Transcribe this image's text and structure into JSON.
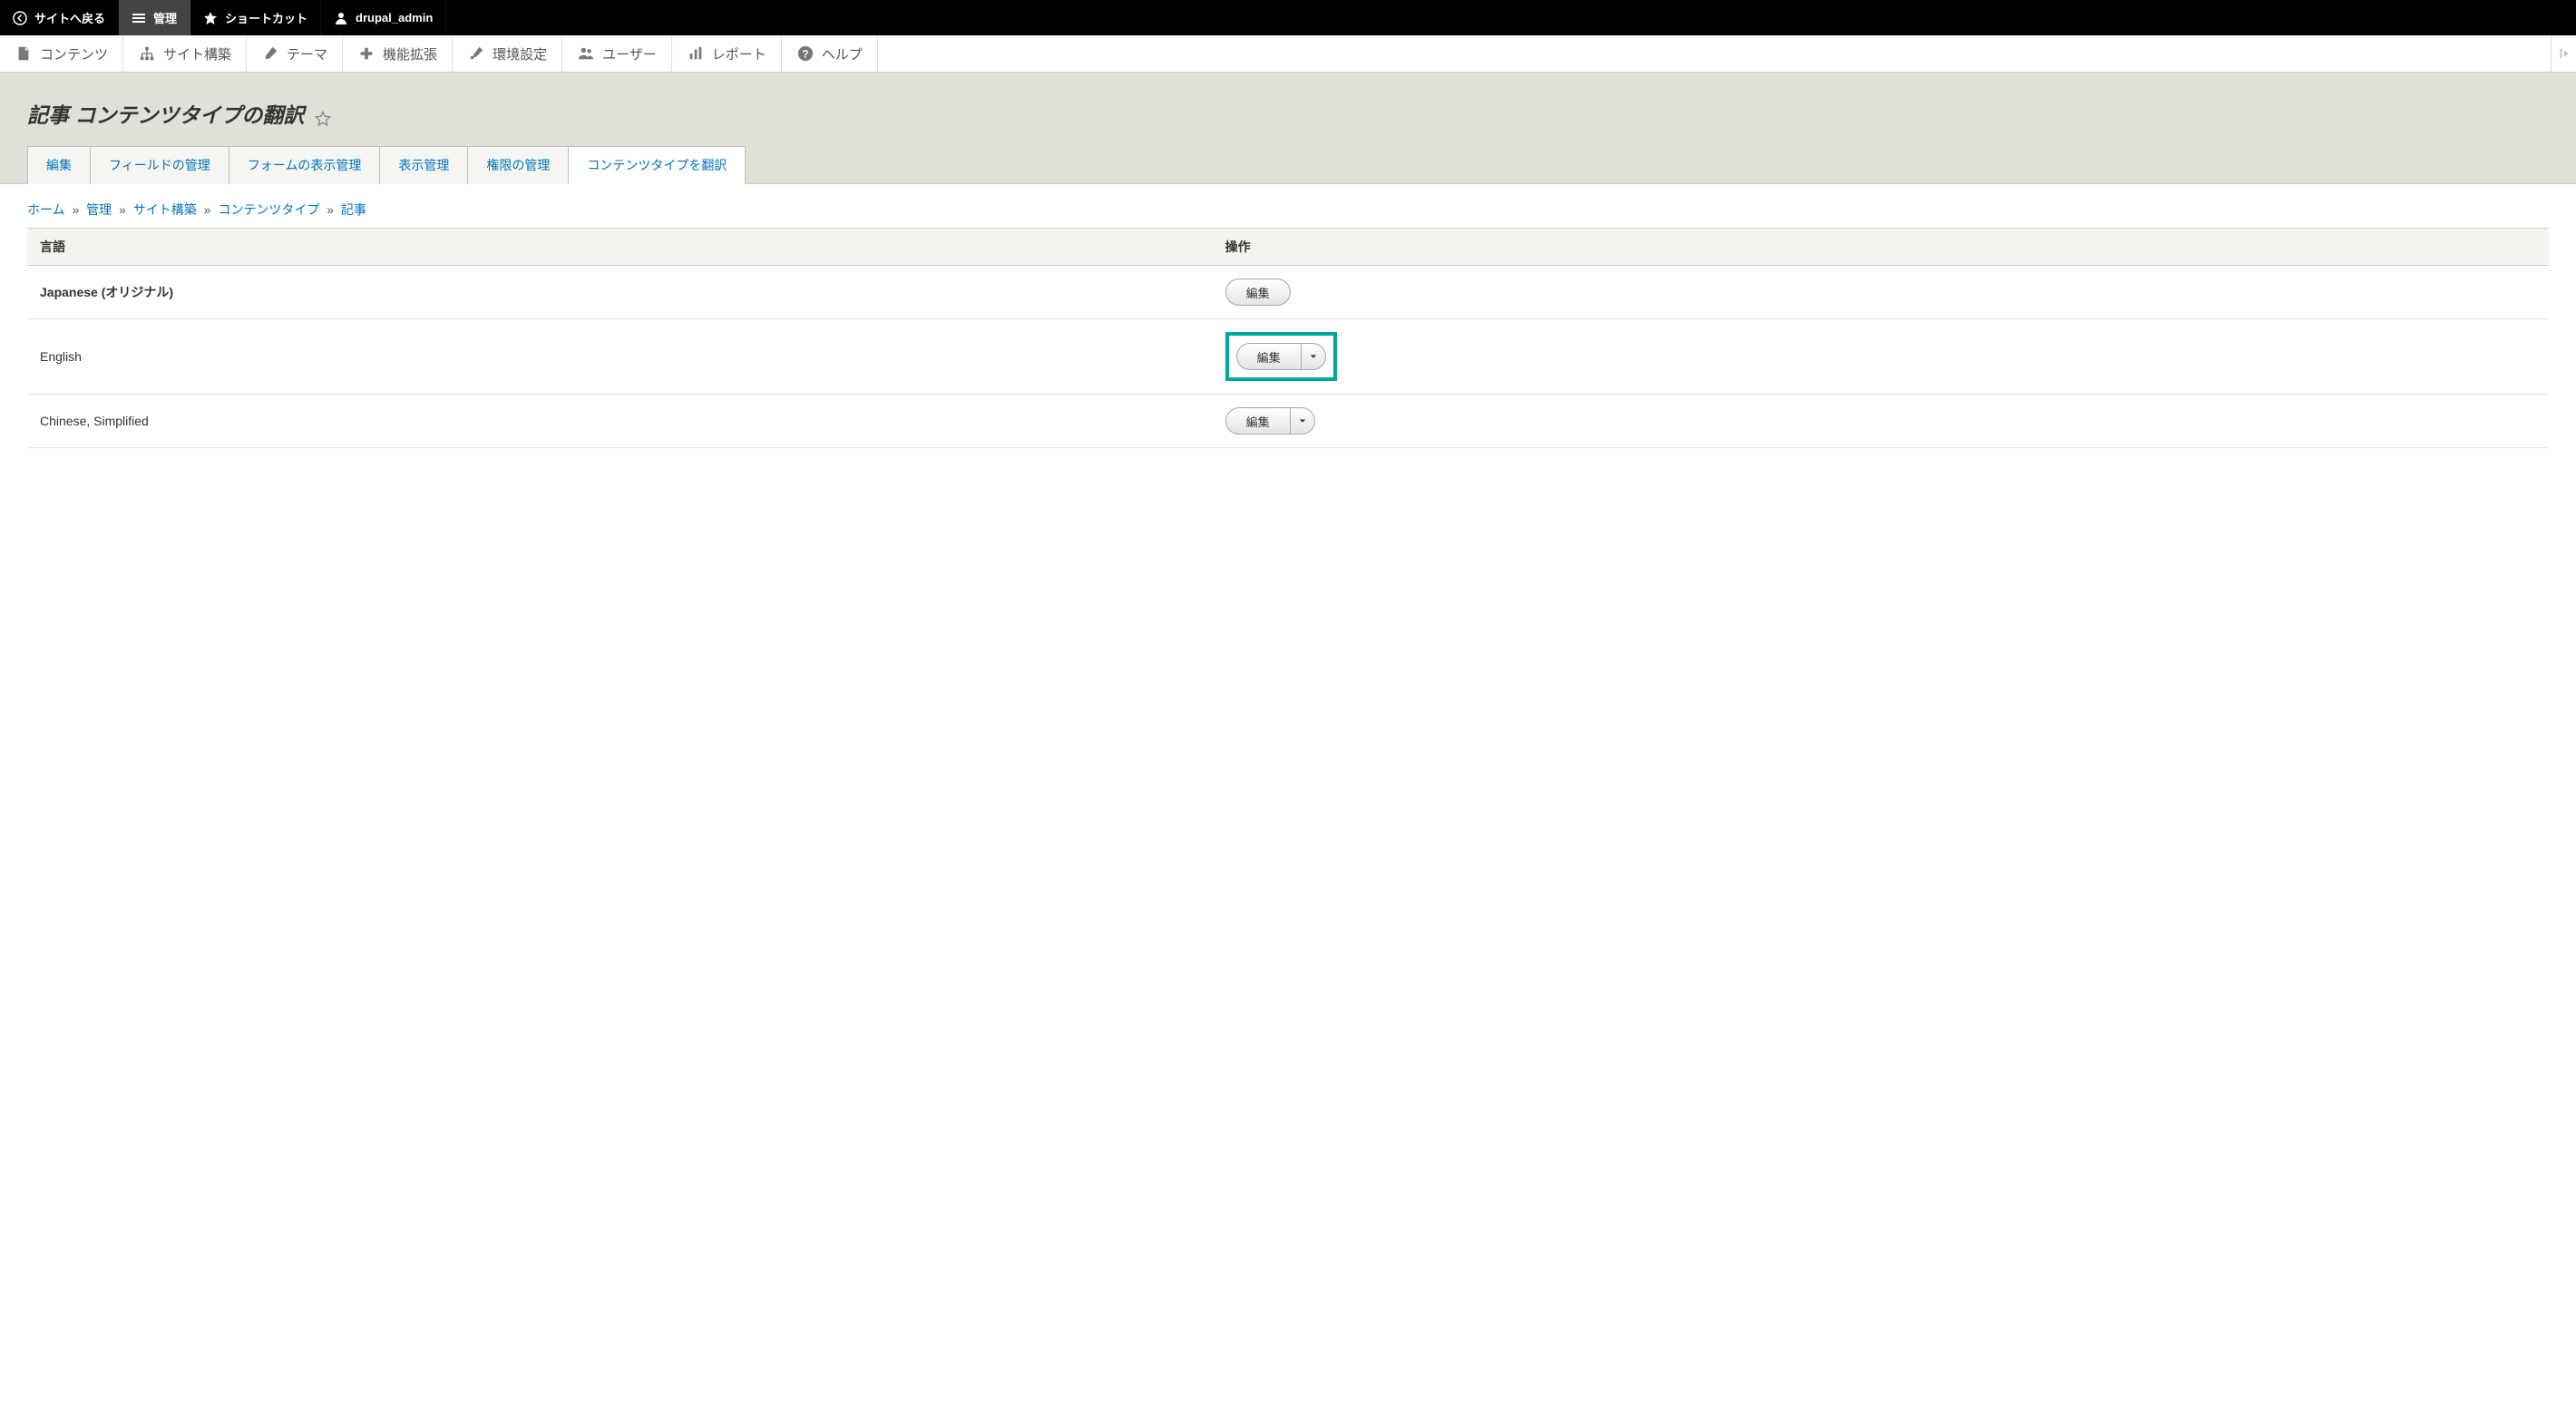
{
  "toolbar": {
    "back_to_site": "サイトへ戻る",
    "manage": "管理",
    "shortcuts": "ショートカット",
    "user": "drupal_admin"
  },
  "admin_menu": {
    "content": "コンテンツ",
    "structure": "サイト構築",
    "appearance": "テーマ",
    "extend": "機能拡張",
    "config": "環境設定",
    "people": "ユーザー",
    "reports": "レポート",
    "help": "ヘルプ"
  },
  "page_title": "記事 コンテンツタイプの翻訳",
  "tabs": {
    "edit": "編集",
    "manage_fields": "フィールドの管理",
    "manage_form_display": "フォームの表示管理",
    "manage_display": "表示管理",
    "manage_permissions": "権限の管理",
    "translate": "コンテンツタイプを翻訳"
  },
  "breadcrumb": {
    "home": "ホーム",
    "manage": "管理",
    "structure": "サイト構築",
    "content_types": "コンテンツタイプ",
    "article": "記事"
  },
  "table": {
    "headers": {
      "language": "言語",
      "operations": "操作"
    },
    "rows": [
      {
        "language": "Japanese (オリジナル)",
        "bold": true,
        "split": false
      },
      {
        "language": "English",
        "bold": false,
        "split": true,
        "highlight": true
      },
      {
        "language": "Chinese, Simplified",
        "bold": false,
        "split": true
      }
    ],
    "edit_label": "編集"
  }
}
